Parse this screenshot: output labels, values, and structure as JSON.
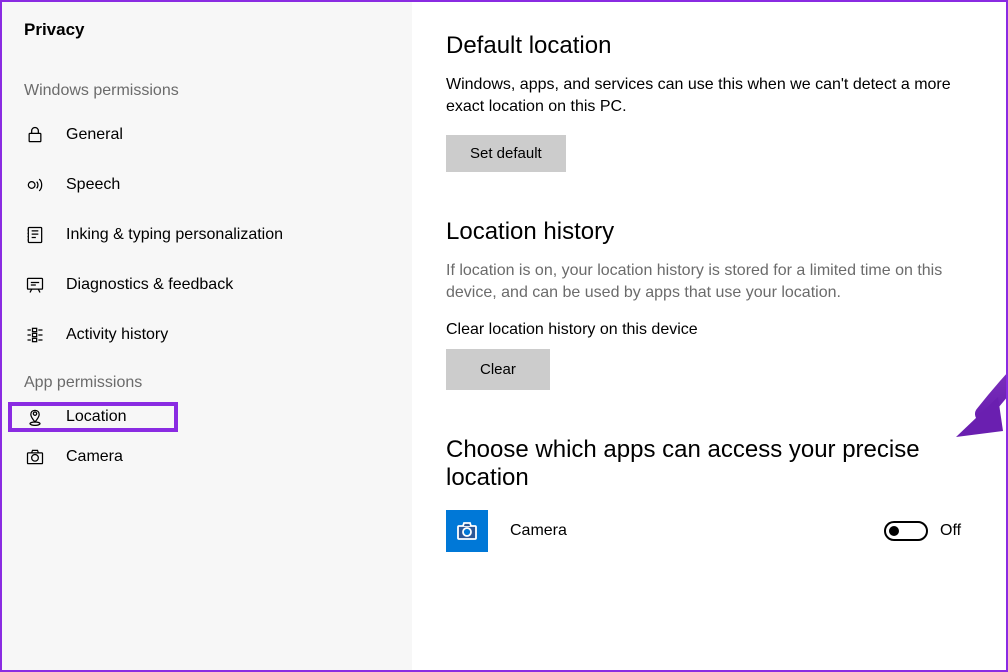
{
  "sidebar": {
    "title": "Privacy",
    "sections": [
      {
        "header": "Windows permissions",
        "items": [
          {
            "label": "General"
          },
          {
            "label": "Speech"
          },
          {
            "label": "Inking & typing personalization"
          },
          {
            "label": "Diagnostics & feedback"
          },
          {
            "label": "Activity history"
          }
        ]
      },
      {
        "header": "App permissions",
        "items": [
          {
            "label": "Location"
          },
          {
            "label": "Camera"
          }
        ]
      }
    ]
  },
  "content": {
    "defaultLocation": {
      "heading": "Default location",
      "text": "Windows, apps, and services can use this when we can't detect a more exact location on this PC.",
      "button": "Set default"
    },
    "locationHistory": {
      "heading": "Location history",
      "text": "If location is on, your location history is stored for a limited time on this device, and can be used by apps that use your location.",
      "label": "Clear location history on this device",
      "button": "Clear"
    },
    "appsAccess": {
      "heading": "Choose which apps can access your precise location",
      "apps": [
        {
          "name": "Camera",
          "state": "Off"
        }
      ]
    }
  }
}
